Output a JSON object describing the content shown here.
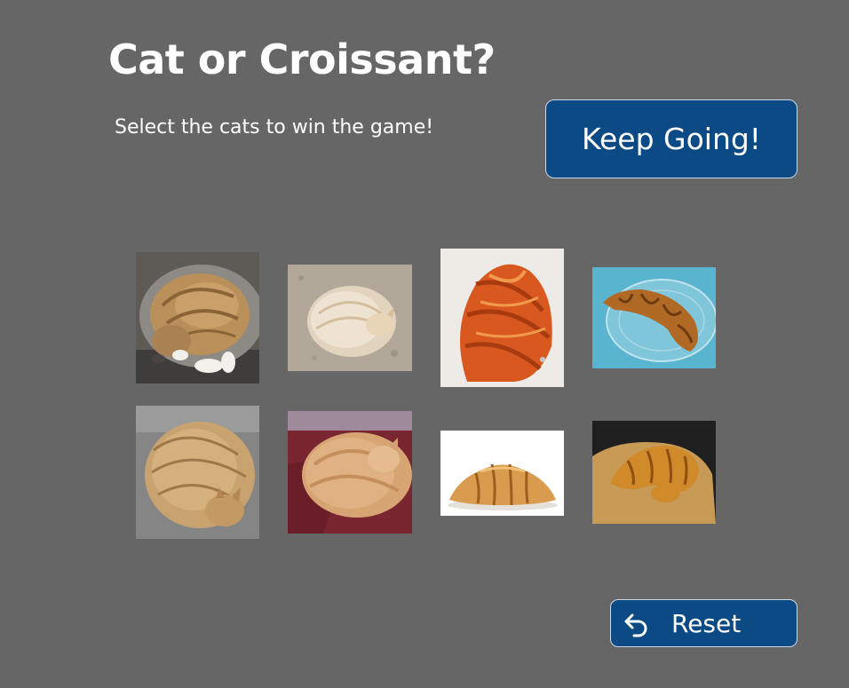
{
  "header": {
    "title": "Cat or Croissant?",
    "subtitle": "Select the cats to win the game!"
  },
  "buttons": {
    "keep_going_label": "Keep Going!",
    "reset_label": "Reset",
    "reset_icon": "undo-arrow-icon"
  },
  "colors": {
    "background": "#666666",
    "button_fill": "#0b4a84",
    "button_border": "#cfd9e6",
    "text": "#ffffff"
  },
  "grid": {
    "rows": 2,
    "columns": 4,
    "tiles": [
      {
        "row": 1,
        "col": 1,
        "subject": "cat",
        "description": "orange tabby cat curled up asleep on grey cushion"
      },
      {
        "row": 1,
        "col": 2,
        "subject": "cat",
        "description": "cream fluffy cat curled in a ball on carpet"
      },
      {
        "row": 1,
        "col": 3,
        "subject": "croissant",
        "description": "golden croissant close-up"
      },
      {
        "row": 1,
        "col": 4,
        "subject": "croissant",
        "description": "croissant on a glass plate, blue background"
      },
      {
        "row": 2,
        "col": 1,
        "subject": "cat",
        "description": "ginger tabby cat curled up on grey blanket"
      },
      {
        "row": 2,
        "col": 2,
        "subject": "cat",
        "description": "fluffy ginger cat curled on red fabric"
      },
      {
        "row": 2,
        "col": 3,
        "subject": "croissant",
        "description": "croissant on white background"
      },
      {
        "row": 2,
        "col": 4,
        "subject": "croissant",
        "description": "croissant on wooden board, dark background"
      }
    ]
  }
}
